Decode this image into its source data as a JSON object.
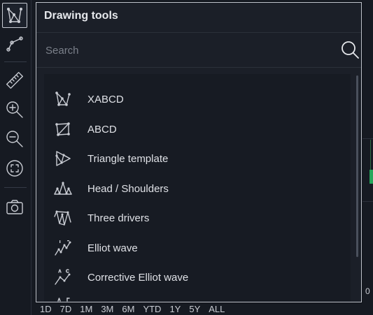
{
  "panel": {
    "title": "Drawing tools",
    "search_placeholder": "Search",
    "items": [
      {
        "label": "XABCD",
        "icon": "xabcd-pattern-icon"
      },
      {
        "label": "ABCD",
        "icon": "abcd-pattern-icon"
      },
      {
        "label": "Triangle template",
        "icon": "triangle-pattern-icon"
      },
      {
        "label": "Head / Shoulders",
        "icon": "head-shoulders-icon"
      },
      {
        "label": "Three drivers",
        "icon": "three-drivers-icon"
      },
      {
        "label": "Elliot wave",
        "icon": "elliot-wave-icon"
      },
      {
        "label": "Corrective Elliot wave",
        "icon": "corrective-elliot-wave-icon"
      }
    ]
  },
  "toolbar": {
    "tools": [
      "pattern-tool-icon",
      "line-tool-icon",
      "ruler-icon",
      "zoom-in-icon",
      "zoom-out-icon",
      "fit-screen-icon",
      "camera-icon"
    ]
  },
  "ranges": [
    "1D",
    "7D",
    "1M",
    "3M",
    "6M",
    "YTD",
    "1Y",
    "5Y",
    "ALL"
  ],
  "axis_value": "0",
  "colors": {
    "accent_green": "#26a65b",
    "panel_bg": "#1b1f28",
    "page_bg": "#161a22"
  }
}
